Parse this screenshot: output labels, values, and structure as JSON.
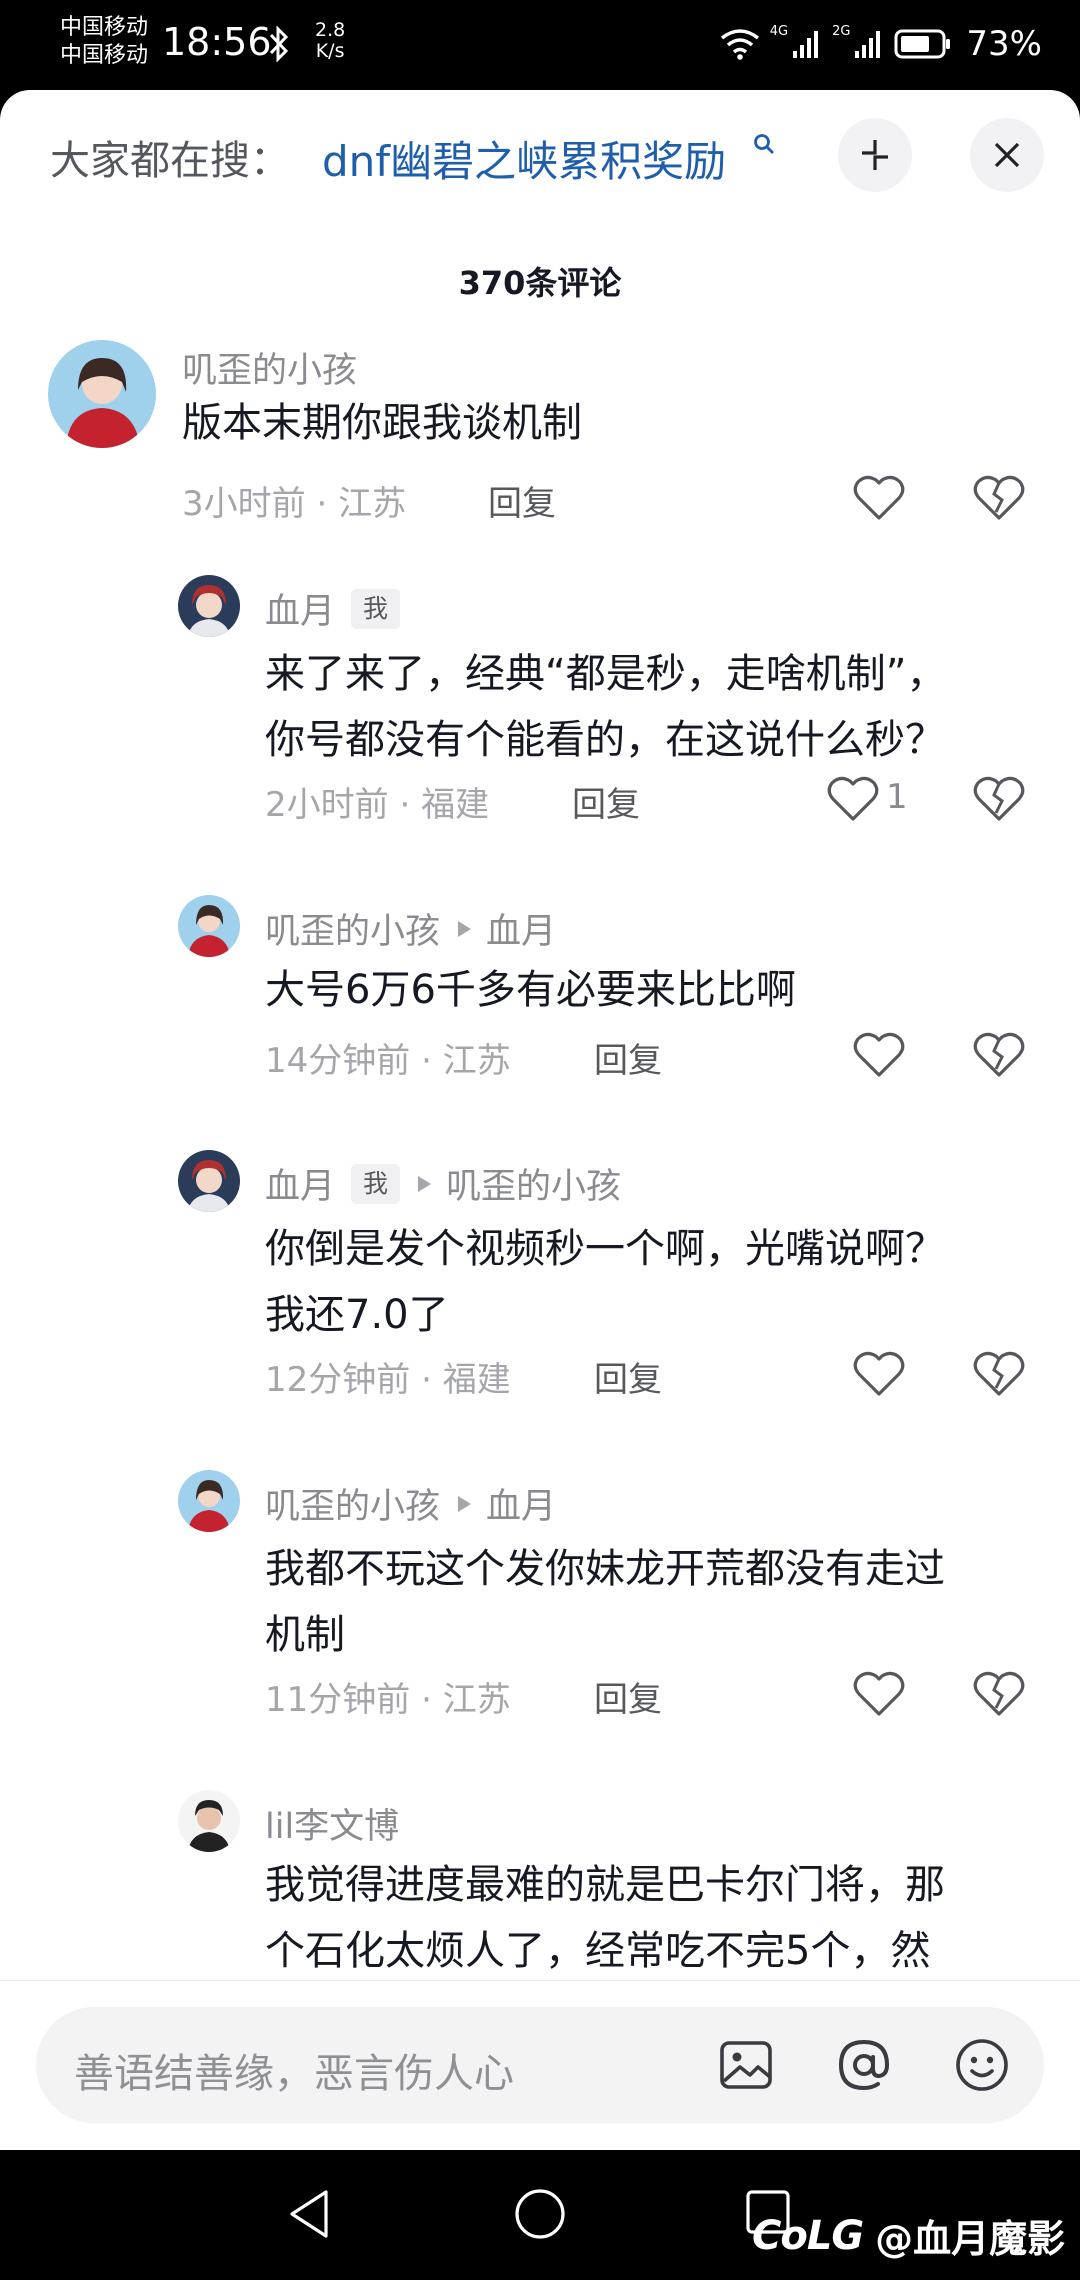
{
  "status_bar": {
    "carrier_1": "中国移动",
    "carrier_2": "中国移动",
    "time": "18:56",
    "speed_value": "2.8",
    "speed_unit": "K/s",
    "sig1_label": "4G",
    "sig2_label": "2G",
    "battery": "73%"
  },
  "header": {
    "search_prefix": "大家都在搜：",
    "search_keyword": "dnf幽碧之峡累积奖励"
  },
  "comment_count": "370条评论",
  "comments": [
    {
      "name": "叽歪的小孩",
      "text_lines": [
        "版本末期你跟我谈机制"
      ],
      "time": "3小时前",
      "location": "江苏",
      "reply_label": "回复",
      "likes": ""
    },
    {
      "name": "血月",
      "badge": "我",
      "text_lines": [
        "来了来了，经典“都是秒，走啥机制”，",
        "你号都没有个能看的，在这说什么秒？"
      ],
      "time": "2小时前",
      "location": "福建",
      "reply_label": "回复",
      "likes": "1"
    },
    {
      "name": "叽歪的小孩",
      "reply_to": "血月",
      "text_lines": [
        "大号6万6千多有必要来比比啊"
      ],
      "time": "14分钟前",
      "location": "江苏",
      "reply_label": "回复",
      "likes": ""
    },
    {
      "name": "血月",
      "badge": "我",
      "reply_to": "叽歪的小孩",
      "text_lines": [
        "你倒是发个视频秒一个啊，光嘴说啊？",
        "我还7.0了"
      ],
      "time": "12分钟前",
      "location": "福建",
      "reply_label": "回复",
      "likes": ""
    },
    {
      "name": "叽歪的小孩",
      "reply_to": "血月",
      "text_lines": [
        "我都不玩这个发你妹龙开荒都没有走过",
        "机制"
      ],
      "time": "11分钟前",
      "location": "江苏",
      "reply_label": "回复",
      "likes": ""
    },
    {
      "name": "lil李文博",
      "text_lines": [
        "我觉得进度最难的就是巴卡尔门将，那",
        "个石化太烦人了，经常吃不完5个，然"
      ]
    }
  ],
  "input": {
    "placeholder": "善语结善缘，恶言伤人心"
  },
  "watermark": {
    "logo": "CoLG",
    "handle": "@血月魔影"
  },
  "colors": {
    "keyword": "#1f5eab",
    "text": "#161823",
    "meta": "#a5a6ab"
  }
}
